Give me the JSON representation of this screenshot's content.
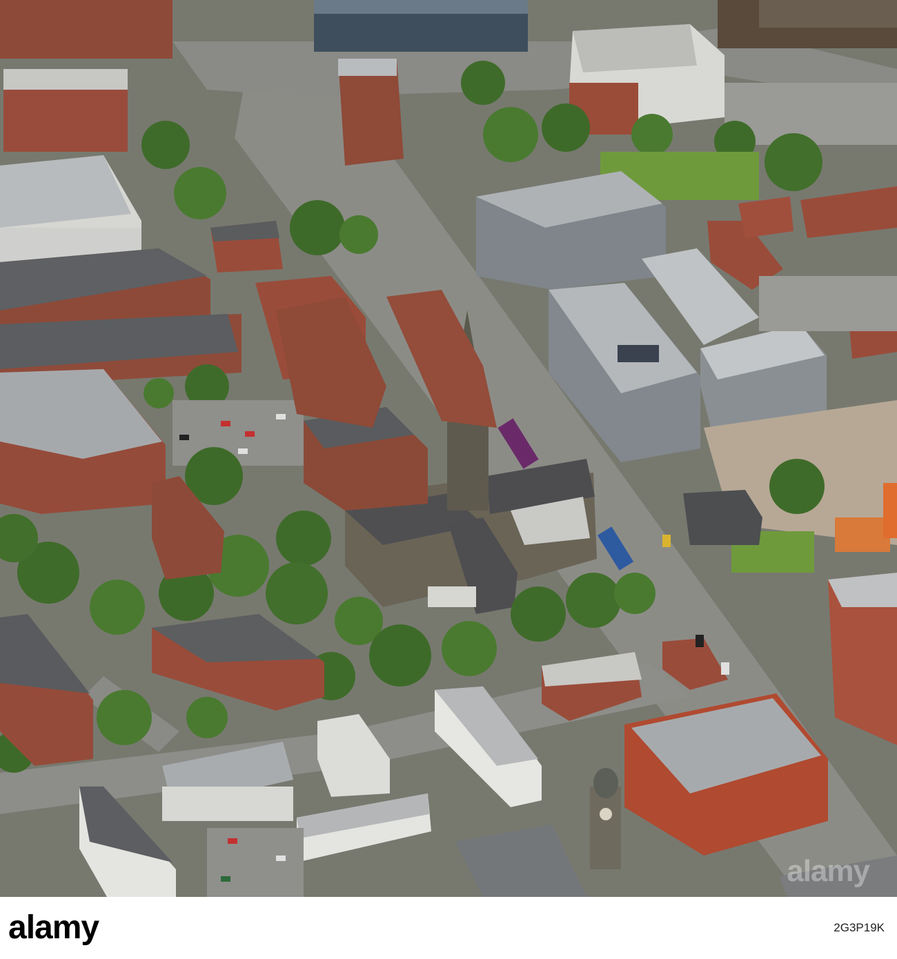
{
  "photo": {
    "subject": "Aerial photograph of a city centre: a Gothic church with a spire beside a wide road, modern apartment blocks under construction, red-brick housing and a domed clock tower",
    "palette": {
      "road": "#8a8a86",
      "brick": "#9a4a3a",
      "roof_grey": "#5c5e60",
      "flat_roof": "#b9bcbf",
      "tree": "#3f6b2a",
      "grass": "#6f9a3c",
      "stone": "#6a6456",
      "cladding": "#7f858a"
    }
  },
  "stock_bar": {
    "logo_text": "alamy",
    "image_id": "2G3P19K",
    "watermark_text": "alamy"
  }
}
